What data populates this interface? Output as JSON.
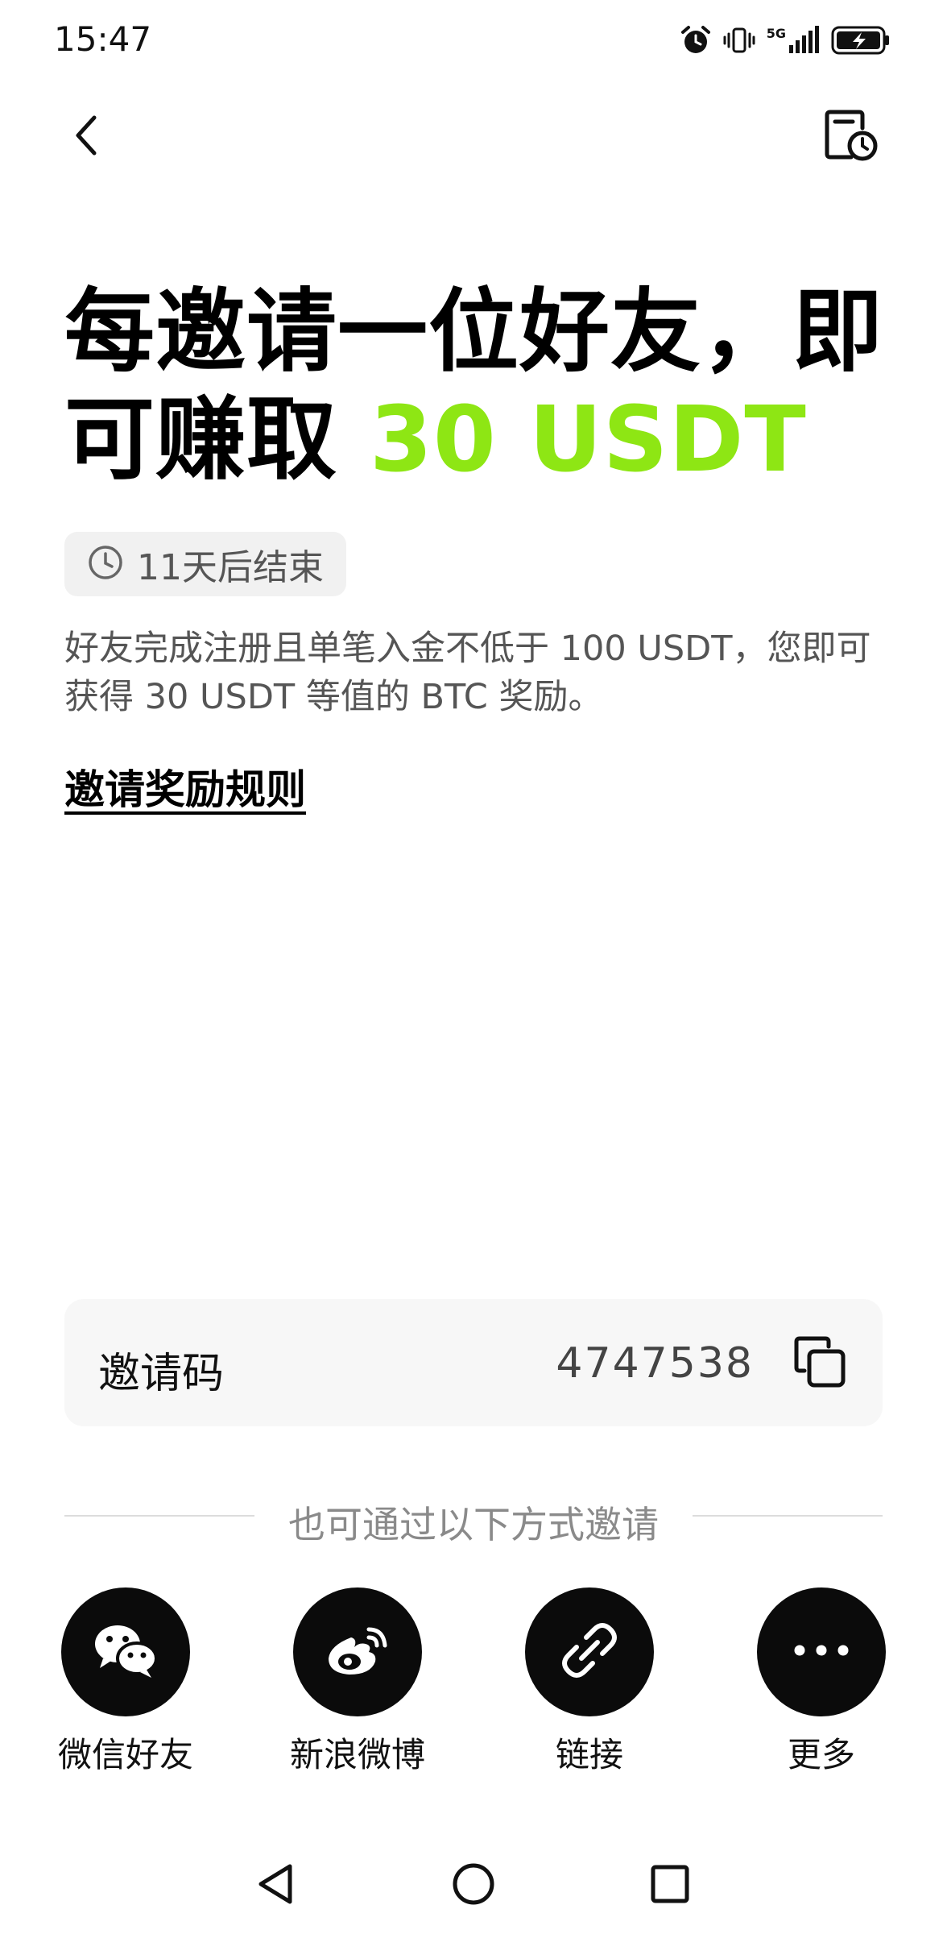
{
  "status_bar": {
    "time": "15:47",
    "network": "5G",
    "icons": [
      "alarm-icon",
      "vibrate-icon",
      "signal-icon",
      "battery-charging-icon"
    ]
  },
  "nav": {
    "back_icon": "chevron-left-icon",
    "history_icon": "document-clock-icon"
  },
  "headline": {
    "line1": "每邀请一位好友，即",
    "line2_prefix": "可赚取 ",
    "line2_accent": "30 USDT",
    "accent_color": "#8ee614"
  },
  "timer": {
    "text": "11天后结束",
    "icon": "clock-icon"
  },
  "description": "好友完成注册且单笔入金不低于 100 USDT，您即可获得 30 USDT 等值的 BTC 奖励。",
  "rules_link": "邀请奖励规则",
  "invite_code": {
    "label": "邀请码",
    "value": "4747538",
    "copy_icon": "copy-icon"
  },
  "alt_invite_text": "也可通过以下方式邀请",
  "share_options": [
    {
      "label": "微信好友",
      "icon": "wechat-icon"
    },
    {
      "label": "新浪微博",
      "icon": "weibo-icon"
    },
    {
      "label": "链接",
      "icon": "link-icon"
    },
    {
      "label": "更多",
      "icon": "more-icon"
    }
  ],
  "system_nav": [
    "back-triangle-icon",
    "home-circle-icon",
    "recents-square-icon"
  ]
}
